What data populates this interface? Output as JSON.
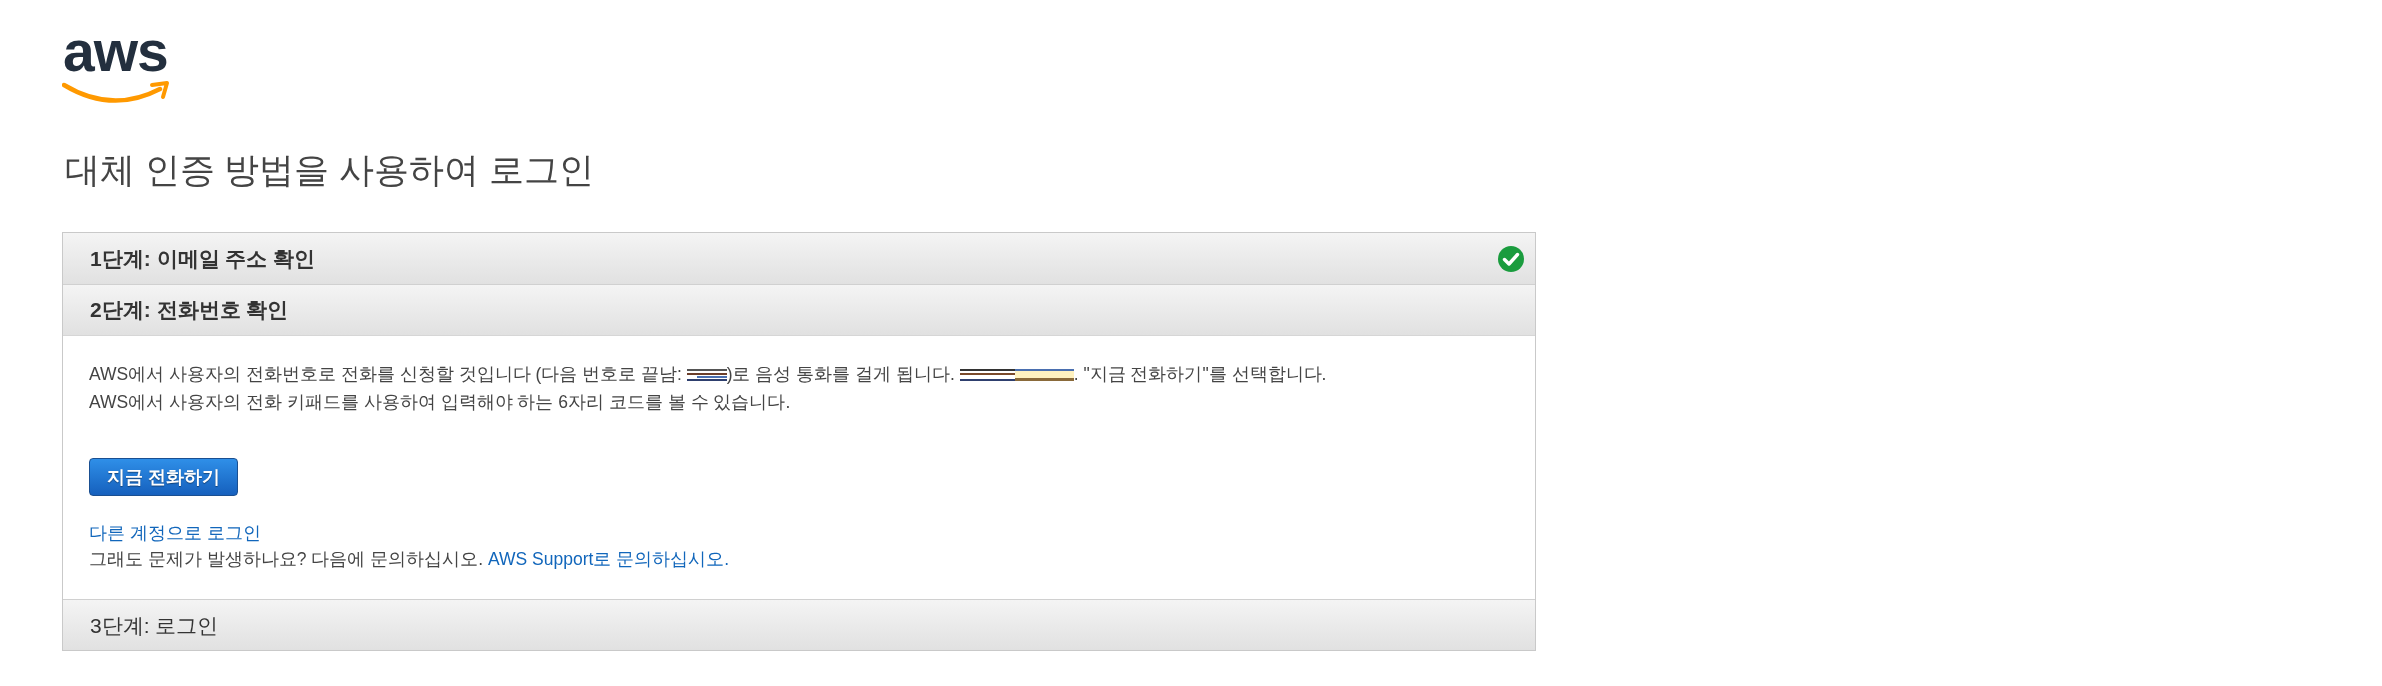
{
  "logo": {
    "text": "aws"
  },
  "title": "대체 인증 방법을 사용하여 로그인",
  "steps": [
    {
      "label": "1단계: 이메일 주소 확인",
      "completed": true,
      "expanded": false
    },
    {
      "label": "2단계: 전화번호 확인",
      "completed": false,
      "expanded": true,
      "content": {
        "message": [
          {
            "kind": "text",
            "text": "AWS에서 사용자의 전화번호로 전화를 신청할 것입니다 (다음 번호로 끝남: "
          },
          {
            "kind": "redaction",
            "wide": false
          },
          {
            "kind": "text",
            "text": ")로 음성 통화를 걸게 됩니다. "
          },
          {
            "kind": "redaction",
            "wide": true
          },
          {
            "kind": "text",
            "text": ". \"지금 전화하기\"를 선택합니다."
          }
        ],
        "note": "AWS에서 사용자의 전화 키패드를 사용하여 입력해야 하는 6자리 코드를 볼 수 있습니다.",
        "call_button": "지금 전화하기",
        "switch_account_link": "다른 계정으로 로그인",
        "help_prompt": "그래도 문제가 발생하나요? 다음에 문의하십시오.",
        "support_link": "AWS Support로 문의하십시오."
      }
    },
    {
      "label": "3단계: 로그인",
      "completed": false,
      "expanded": false
    }
  ]
}
